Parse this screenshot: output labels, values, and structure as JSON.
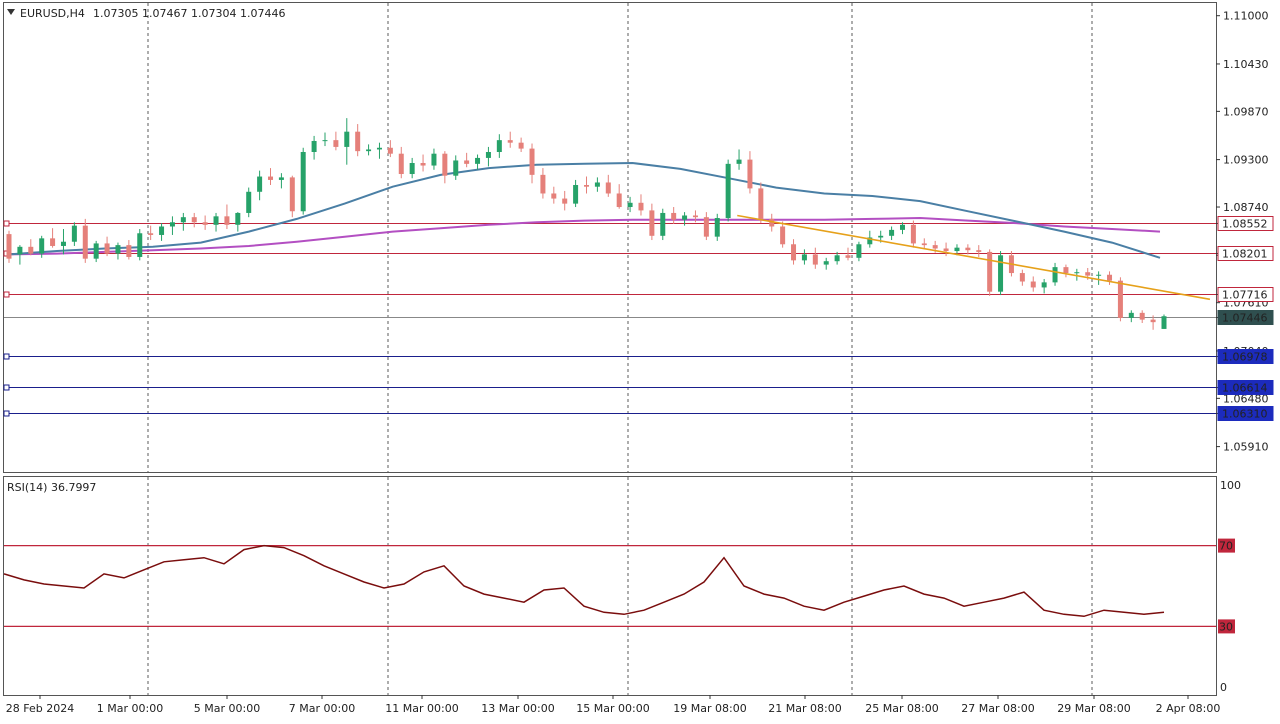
{
  "header": {
    "symbol": "EURUSD,H4",
    "ohlc": "1.07305 1.07467 1.07304 1.07446"
  },
  "rsi_header": "RSI(14) 36.7997",
  "colors": {
    "bull": "#26a269",
    "bear": "#e5807a",
    "ma_fast": "#4a7fa5",
    "ma_slow": "#b34fc2",
    "trendline": "#e6a11a",
    "resistance": "#c0263c",
    "support": "#1a1f8c",
    "rsi_line": "#7a0d0d",
    "rsi_levels": "#c0263c"
  },
  "price_axis": {
    "ticks": [
      "1.11000",
      "1.10430",
      "1.09870",
      "1.09300",
      "1.08740",
      "1.08170",
      "1.07610",
      "1.07040",
      "1.06480",
      "1.05910"
    ]
  },
  "levels": [
    {
      "value": "1.08552",
      "price": 1.08552,
      "kind": "resistance"
    },
    {
      "value": "1.08201",
      "price": 1.08201,
      "kind": "resistance"
    },
    {
      "value": "1.07716",
      "price": 1.07716,
      "kind": "resistance"
    },
    {
      "value": "1.07446",
      "price": 1.07446,
      "kind": "current"
    },
    {
      "value": "1.06978",
      "price": 1.06978,
      "kind": "support"
    },
    {
      "value": "1.06614",
      "price": 1.06614,
      "kind": "support"
    },
    {
      "value": "1.06310",
      "price": 1.0631,
      "kind": "support"
    }
  ],
  "time_axis": {
    "labels": [
      "28 Feb 2024",
      "1 Mar 00:00",
      "5 Mar 00:00",
      "7 Mar 00:00",
      "11 Mar 00:00",
      "13 Mar 00:00",
      "15 Mar 00:00",
      "19 Mar 08:00",
      "21 Mar 08:00",
      "25 Mar 08:00",
      "27 Mar 08:00",
      "29 Mar 08:00",
      "2 Apr 08:00"
    ]
  },
  "rsi_axis": {
    "ticks": [
      "100",
      "0"
    ],
    "level_labels": [
      "70",
      "30"
    ]
  },
  "chart_data": {
    "type": "candlestick",
    "symbol": "EURUSD",
    "timeframe": "H4",
    "ylim": [
      1.0561,
      1.1115
    ],
    "rsi_levels": [
      70,
      30
    ],
    "rsi_ylim": [
      0,
      100
    ],
    "trendline": [
      [
        1.0864,
        0.605
      ],
      [
        1.0765,
        0.995
      ]
    ],
    "ma_fast": [
      1.0818,
      1.0822,
      1.0825,
      1.0827,
      1.0832,
      1.0845,
      1.086,
      1.0878,
      1.0898,
      1.0912,
      1.092,
      1.0924,
      1.0925,
      1.0926,
      1.0919,
      1.0908,
      1.0897,
      1.089,
      1.0887,
      1.0881,
      1.0869,
      1.0857,
      1.0845,
      1.0832,
      1.0814
    ],
    "ma_slow": [
      1.0818,
      1.0819,
      1.0821,
      1.0823,
      1.0825,
      1.0828,
      1.0833,
      1.0839,
      1.0845,
      1.0849,
      1.0853,
      1.0856,
      1.0858,
      1.0859,
      1.0859,
      1.0859,
      1.0859,
      1.0859,
      1.086,
      1.0861,
      1.0858,
      1.0855,
      1.0851,
      1.0848,
      1.0845
    ],
    "rsi": [
      56,
      53,
      51,
      50,
      49,
      56,
      54,
      58,
      62,
      63,
      64,
      61,
      68,
      70,
      69,
      65,
      60,
      56,
      52,
      49,
      51,
      57,
      60,
      50,
      46,
      44,
      42,
      48,
      49,
      40,
      37,
      36,
      38,
      42,
      46,
      52,
      64,
      50,
      46,
      44,
      40,
      38,
      42,
      45,
      48,
      50,
      46,
      44,
      40,
      42,
      44,
      47,
      38,
      36,
      35,
      38,
      37,
      36,
      37
    ],
    "candles": [
      [
        1.0842,
        1.0846,
        1.0808,
        1.0813
      ],
      [
        1.0818,
        1.0829,
        1.0806,
        1.0827
      ],
      [
        1.0827,
        1.0836,
        1.0817,
        1.0819
      ],
      [
        1.0819,
        1.084,
        1.0814,
        1.0837
      ],
      [
        1.0837,
        1.0849,
        1.0826,
        1.0828
      ],
      [
        1.0828,
        1.0848,
        1.0818,
        1.0833
      ],
      [
        1.0833,
        1.0856,
        1.0828,
        1.0852
      ],
      [
        1.0852,
        1.086,
        1.0808,
        1.0813
      ],
      [
        1.0813,
        1.0834,
        1.0809,
        1.0831
      ],
      [
        1.0831,
        1.0839,
        1.0816,
        1.0819
      ],
      [
        1.0819,
        1.0832,
        1.0812,
        1.0829
      ],
      [
        1.0829,
        1.0835,
        1.0812,
        1.0815
      ],
      [
        1.0815,
        1.0848,
        1.0811,
        1.0843
      ],
      [
        1.0843,
        1.0852,
        1.0835,
        1.0841
      ],
      [
        1.0841,
        1.0855,
        1.0834,
        1.0851
      ],
      [
        1.0851,
        1.0863,
        1.0841,
        1.0856
      ],
      [
        1.0856,
        1.0867,
        1.0846,
        1.0862
      ],
      [
        1.0862,
        1.0867,
        1.085,
        1.0856
      ],
      [
        1.0856,
        1.0864,
        1.0847,
        1.0853
      ],
      [
        1.0853,
        1.0867,
        1.0845,
        1.0863
      ],
      [
        1.0863,
        1.0877,
        1.0848,
        1.0853
      ],
      [
        1.0853,
        1.0868,
        1.0845,
        1.0867
      ],
      [
        1.0867,
        1.0897,
        1.0862,
        1.0892
      ],
      [
        1.0892,
        1.0917,
        1.0882,
        1.091
      ],
      [
        1.091,
        1.092,
        1.09,
        1.0906
      ],
      [
        1.0906,
        1.0914,
        1.0896,
        1.0909
      ],
      [
        1.0909,
        1.0911,
        1.0862,
        1.0869
      ],
      [
        1.0869,
        1.0944,
        1.0865,
        1.0939
      ],
      [
        1.0939,
        1.0958,
        1.093,
        1.0952
      ],
      [
        1.0952,
        1.0962,
        1.0946,
        1.0953
      ],
      [
        1.0953,
        1.0963,
        1.0941,
        1.0945
      ],
      [
        1.0945,
        1.0979,
        1.0924,
        1.0963
      ],
      [
        1.0963,
        1.0972,
        1.0934,
        1.094
      ],
      [
        1.094,
        1.0948,
        1.0935,
        1.0942
      ],
      [
        1.0942,
        1.095,
        1.0931,
        1.0944
      ],
      [
        1.0944,
        1.0953,
        1.0933,
        1.0937
      ],
      [
        1.0937,
        1.0945,
        1.0908,
        1.0913
      ],
      [
        1.0913,
        1.0932,
        1.0908,
        1.0926
      ],
      [
        1.0926,
        1.0936,
        1.0916,
        1.0923
      ],
      [
        1.0923,
        1.0943,
        1.0918,
        1.0937
      ],
      [
        1.0937,
        1.094,
        1.0902,
        1.0911
      ],
      [
        1.0911,
        1.0935,
        1.0906,
        1.0929
      ],
      [
        1.0929,
        1.0938,
        1.0921,
        1.0925
      ],
      [
        1.0925,
        1.0936,
        1.0918,
        1.0932
      ],
      [
        1.0932,
        1.0945,
        1.0922,
        1.0939
      ],
      [
        1.0939,
        1.096,
        1.0932,
        1.0953
      ],
      [
        1.0953,
        1.0963,
        1.0944,
        1.095
      ],
      [
        1.095,
        1.0956,
        1.0939,
        1.0943
      ],
      [
        1.0943,
        1.0949,
        1.0902,
        1.0912
      ],
      [
        1.0912,
        1.092,
        1.0884,
        1.089
      ],
      [
        1.089,
        1.0898,
        1.0878,
        1.0884
      ],
      [
        1.0884,
        1.0893,
        1.087,
        1.0878
      ],
      [
        1.0878,
        1.0906,
        1.0874,
        1.09
      ],
      [
        1.09,
        1.091,
        1.089,
        1.0898
      ],
      [
        1.0898,
        1.0909,
        1.0892,
        1.0903
      ],
      [
        1.0903,
        1.0912,
        1.0886,
        1.089
      ],
      [
        1.089,
        1.0901,
        1.0872,
        1.0874
      ],
      [
        1.0874,
        1.0886,
        1.0868,
        1.0879
      ],
      [
        1.0879,
        1.0889,
        1.0864,
        1.087
      ],
      [
        1.087,
        1.0878,
        1.0835,
        1.084
      ],
      [
        1.084,
        1.0872,
        1.0835,
        1.0867
      ],
      [
        1.0867,
        1.0874,
        1.0854,
        1.0859
      ],
      [
        1.0859,
        1.0868,
        1.0852,
        1.0864
      ],
      [
        1.0864,
        1.087,
        1.0856,
        1.0862
      ],
      [
        1.0862,
        1.0868,
        1.0835,
        1.0839
      ],
      [
        1.0839,
        1.0866,
        1.0834,
        1.0861
      ],
      [
        1.0861,
        1.093,
        1.0857,
        1.0925
      ],
      [
        1.0925,
        1.0942,
        1.0918,
        1.093
      ],
      [
        1.093,
        1.094,
        1.089,
        1.0896
      ],
      [
        1.0896,
        1.0903,
        1.0855,
        1.086
      ],
      [
        1.086,
        1.0866,
        1.0845,
        1.0851
      ],
      [
        1.0851,
        1.0857,
        1.0826,
        1.083
      ],
      [
        1.083,
        1.0836,
        1.0806,
        1.0811
      ],
      [
        1.0811,
        1.0824,
        1.0806,
        1.0818
      ],
      [
        1.0818,
        1.0826,
        1.0801,
        1.0806
      ],
      [
        1.0806,
        1.0814,
        1.08,
        1.081
      ],
      [
        1.081,
        1.0821,
        1.0806,
        1.0817
      ],
      [
        1.0817,
        1.0826,
        1.0811,
        1.0814
      ],
      [
        1.0814,
        1.0833,
        1.081,
        1.083
      ],
      [
        1.083,
        1.0846,
        1.0826,
        1.0838
      ],
      [
        1.0838,
        1.0846,
        1.0832,
        1.084
      ],
      [
        1.084,
        1.0851,
        1.0835,
        1.0847
      ],
      [
        1.0847,
        1.0856,
        1.0842,
        1.0853
      ],
      [
        1.0853,
        1.0858,
        1.0826,
        1.0831
      ],
      [
        1.0831,
        1.0837,
        1.0824,
        1.0829
      ],
      [
        1.0829,
        1.0834,
        1.082,
        1.0825
      ],
      [
        1.0825,
        1.0832,
        1.0816,
        1.0822
      ],
      [
        1.0822,
        1.083,
        1.0817,
        1.0826
      ],
      [
        1.0826,
        1.083,
        1.0818,
        1.0823
      ],
      [
        1.0823,
        1.0829,
        1.0815,
        1.0821
      ],
      [
        1.0821,
        1.0824,
        1.0769,
        1.0774
      ],
      [
        1.0774,
        1.0822,
        1.077,
        1.0817
      ],
      [
        1.0817,
        1.0822,
        1.0792,
        1.0796
      ],
      [
        1.0796,
        1.08,
        1.0781,
        1.0786
      ],
      [
        1.0786,
        1.0792,
        1.0774,
        1.0779
      ],
      [
        1.0779,
        1.0789,
        1.0772,
        1.0785
      ],
      [
        1.0785,
        1.0808,
        1.0781,
        1.0803
      ],
      [
        1.0803,
        1.0806,
        1.0791,
        1.0796
      ],
      [
        1.0796,
        1.0801,
        1.0787,
        1.0797
      ],
      [
        1.0797,
        1.0802,
        1.0788,
        1.0793
      ],
      [
        1.0793,
        1.0798,
        1.0782,
        1.0794
      ],
      [
        1.0794,
        1.0798,
        1.0782,
        1.0787
      ],
      [
        1.0787,
        1.0791,
        1.0739,
        1.0743
      ],
      [
        1.0743,
        1.0752,
        1.0738,
        1.0749
      ],
      [
        1.0749,
        1.0752,
        1.0737,
        1.0741
      ],
      [
        1.0741,
        1.0746,
        1.0729,
        1.0738
      ],
      [
        1.073,
        1.0747,
        1.073,
        1.0745
      ]
    ]
  }
}
